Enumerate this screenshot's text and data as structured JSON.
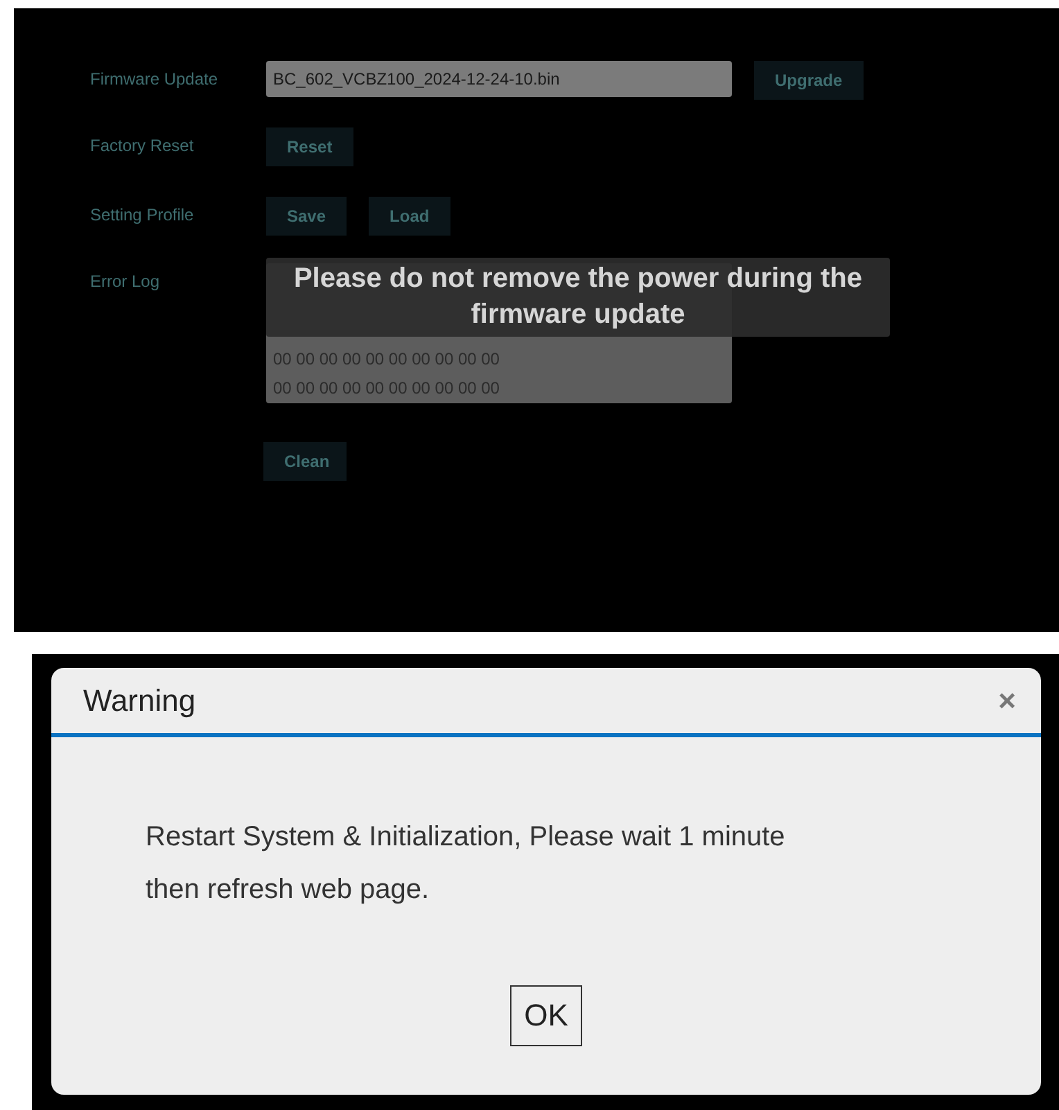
{
  "settings": {
    "rows": [
      {
        "kind": "file",
        "label": "Firmware Update",
        "value": "BC_602_VCBZ100_2024-12-24-10.bin",
        "buttons": [
          "Upgrade"
        ]
      },
      {
        "kind": "buttons",
        "label": "Factory Reset",
        "buttons": [
          "Reset"
        ]
      },
      {
        "kind": "buttons",
        "label": "Setting Profile",
        "buttons": [
          "Save",
          "Load"
        ]
      },
      {
        "kind": "log",
        "label": "Error Log",
        "lines": [
          "00 00 00 00 00 00 00 00 00 00",
          "00 00 00 00 00 00 00 00 00 00"
        ],
        "buttons": [
          "Clean"
        ]
      }
    ],
    "notice": "Please do not remove the power during the firmware update"
  },
  "dialog": {
    "title": "Warning",
    "close": "×",
    "message": "Restart System & Initialization, Please wait 1 minute then refresh web page.",
    "button": "OK"
  }
}
